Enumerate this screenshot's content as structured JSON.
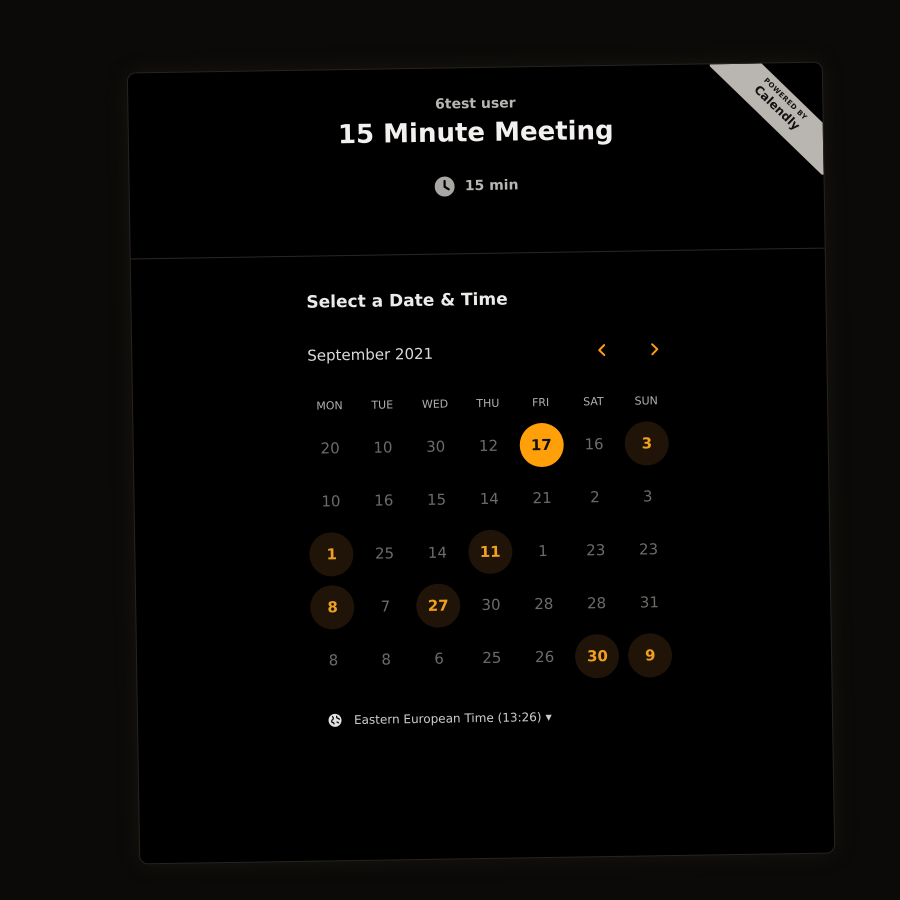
{
  "colors": {
    "accent": "#ff9f0a",
    "background": "#000000",
    "available_bg": "#1f1407"
  },
  "badge": {
    "line1": "POWERED BY",
    "line2": "Calendly"
  },
  "header": {
    "host": "6test user",
    "title": "15 Minute Meeting",
    "duration": "15 min",
    "duration_icon": "clock-icon"
  },
  "scheduler": {
    "section_title": "Select a Date & Time",
    "month": "September 2021",
    "prev_icon": "chevron-left-icon",
    "next_icon": "chevron-right-icon",
    "weekdays": [
      "MON",
      "TUE",
      "WED",
      "THU",
      "FRI",
      "SAT",
      "SUN"
    ],
    "days": [
      {
        "n": "20",
        "state": "unavailable"
      },
      {
        "n": "10",
        "state": "unavailable"
      },
      {
        "n": "30",
        "state": "unavailable"
      },
      {
        "n": "12",
        "state": "unavailable"
      },
      {
        "n": "17",
        "state": "selected"
      },
      {
        "n": "16",
        "state": "unavailable"
      },
      {
        "n": "3",
        "state": "available"
      },
      {
        "n": "10",
        "state": "unavailable"
      },
      {
        "n": "16",
        "state": "unavailable"
      },
      {
        "n": "15",
        "state": "unavailable"
      },
      {
        "n": "14",
        "state": "unavailable"
      },
      {
        "n": "21",
        "state": "unavailable"
      },
      {
        "n": "2",
        "state": "unavailable"
      },
      {
        "n": "3",
        "state": "unavailable"
      },
      {
        "n": "1",
        "state": "available"
      },
      {
        "n": "25",
        "state": "unavailable"
      },
      {
        "n": "14",
        "state": "unavailable"
      },
      {
        "n": "11",
        "state": "available"
      },
      {
        "n": "1",
        "state": "unavailable"
      },
      {
        "n": "23",
        "state": "unavailable"
      },
      {
        "n": "23",
        "state": "unavailable"
      },
      {
        "n": "8",
        "state": "available"
      },
      {
        "n": "7",
        "state": "unavailable"
      },
      {
        "n": "27",
        "state": "available"
      },
      {
        "n": "30",
        "state": "unavailable"
      },
      {
        "n": "28",
        "state": "unavailable"
      },
      {
        "n": "28",
        "state": "unavailable"
      },
      {
        "n": "31",
        "state": "unavailable"
      },
      {
        "n": "8",
        "state": "unavailable"
      },
      {
        "n": "8",
        "state": "unavailable"
      },
      {
        "n": "6",
        "state": "unavailable"
      },
      {
        "n": "25",
        "state": "unavailable"
      },
      {
        "n": "26",
        "state": "unavailable"
      },
      {
        "n": "30",
        "state": "available"
      },
      {
        "n": "9",
        "state": "available"
      }
    ],
    "timezone": "Eastern European Time (13:26)",
    "timezone_icon": "globe-icon"
  }
}
